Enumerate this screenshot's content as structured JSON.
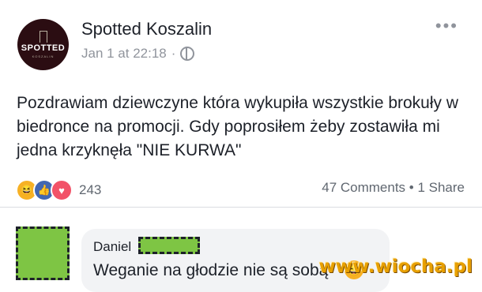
{
  "post": {
    "page_name": "Spotted Koszalin",
    "timestamp": "Jan 1 at 22:18",
    "separator": "·",
    "more_label": "•••",
    "avatar_text": "SPOTTED",
    "avatar_subtext": "KOSZALIN",
    "text": "Pozdrawiam dziewczyne która wykupiła wszystkie brokuły w biedronce na promocji. Gdy poprosiłem żeby zostawiła mi jedna krzyknęła \"NIE KURWA\"",
    "reaction_count": "243",
    "reactions": [
      {
        "name": "haha",
        "icon": "😆"
      },
      {
        "name": "like",
        "icon": "👍"
      },
      {
        "name": "love",
        "icon": "♥"
      }
    ],
    "stats": "47 Comments • 1 Share"
  },
  "comment": {
    "author": "Daniel",
    "text": "Weganie na głodzie nie są sobą",
    "emoji": "😅"
  },
  "watermark": "www.wiocha.pl",
  "colors": {
    "avatar_bg": "#2b0d12",
    "secondary_text": "#90949c",
    "bubble_bg": "#f2f3f5",
    "censor_green": "#7ec544",
    "watermark": "#e8a000"
  }
}
